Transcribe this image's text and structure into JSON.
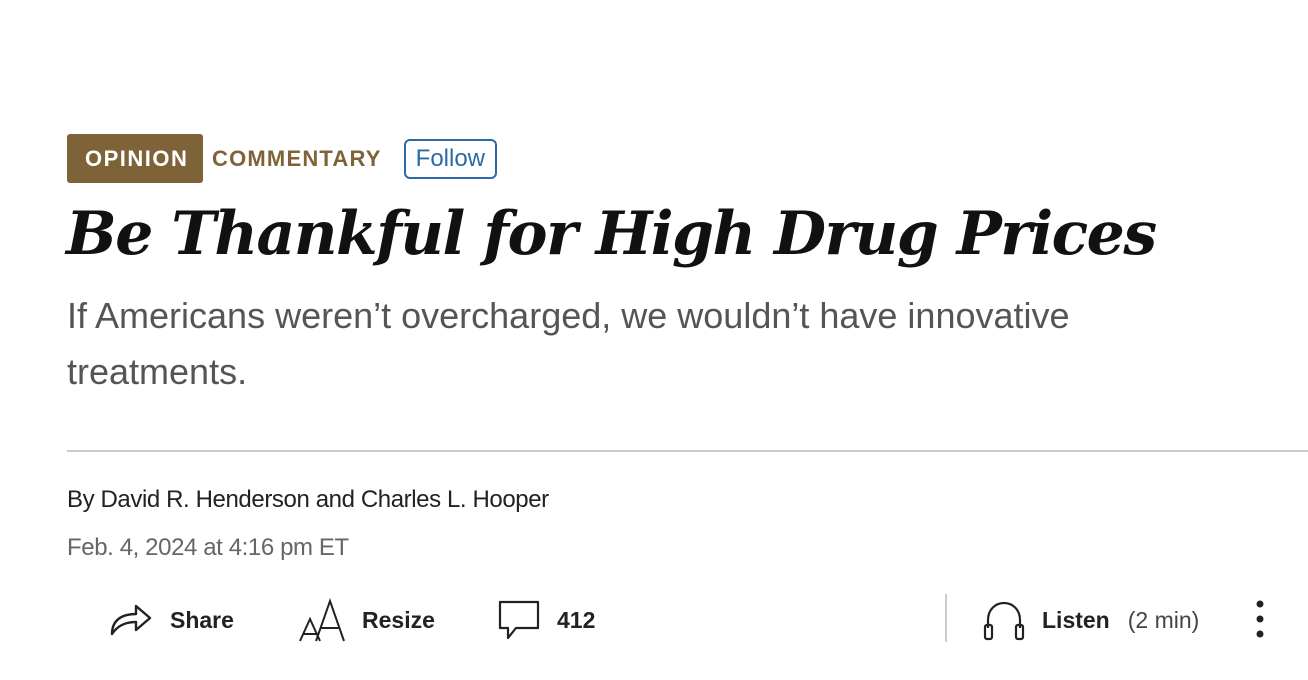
{
  "section": {
    "badge": "OPINION",
    "category": "COMMENTARY",
    "follow_label": "Follow"
  },
  "article": {
    "headline": "Be Thankful for High Drug Prices",
    "dek": "If Americans weren’t overcharged, we wouldn’t have innovative treatments.",
    "byline_prefix": "By",
    "author_1": "David R. Henderson",
    "byline_joiner": "and",
    "author_2": "Charles L. Hooper",
    "timestamp": "Feb. 4, 2024 at 4:16 pm ET"
  },
  "toolbar": {
    "share_label": "Share",
    "resize_label": "Resize",
    "comment_count": "412",
    "listen_label": "Listen",
    "listen_duration": "(2 min)"
  },
  "icons": {
    "share": "share-arrow-icon",
    "resize": "text-resize-icon",
    "comments": "speech-bubble-icon",
    "listen": "headphones-icon",
    "more": "vertical-ellipsis-icon"
  },
  "colors": {
    "opinion_brown": "#7f6338",
    "follow_blue": "#2a6aa8",
    "headline": "#111111",
    "dek": "#555555",
    "divider": "#cccccc"
  }
}
